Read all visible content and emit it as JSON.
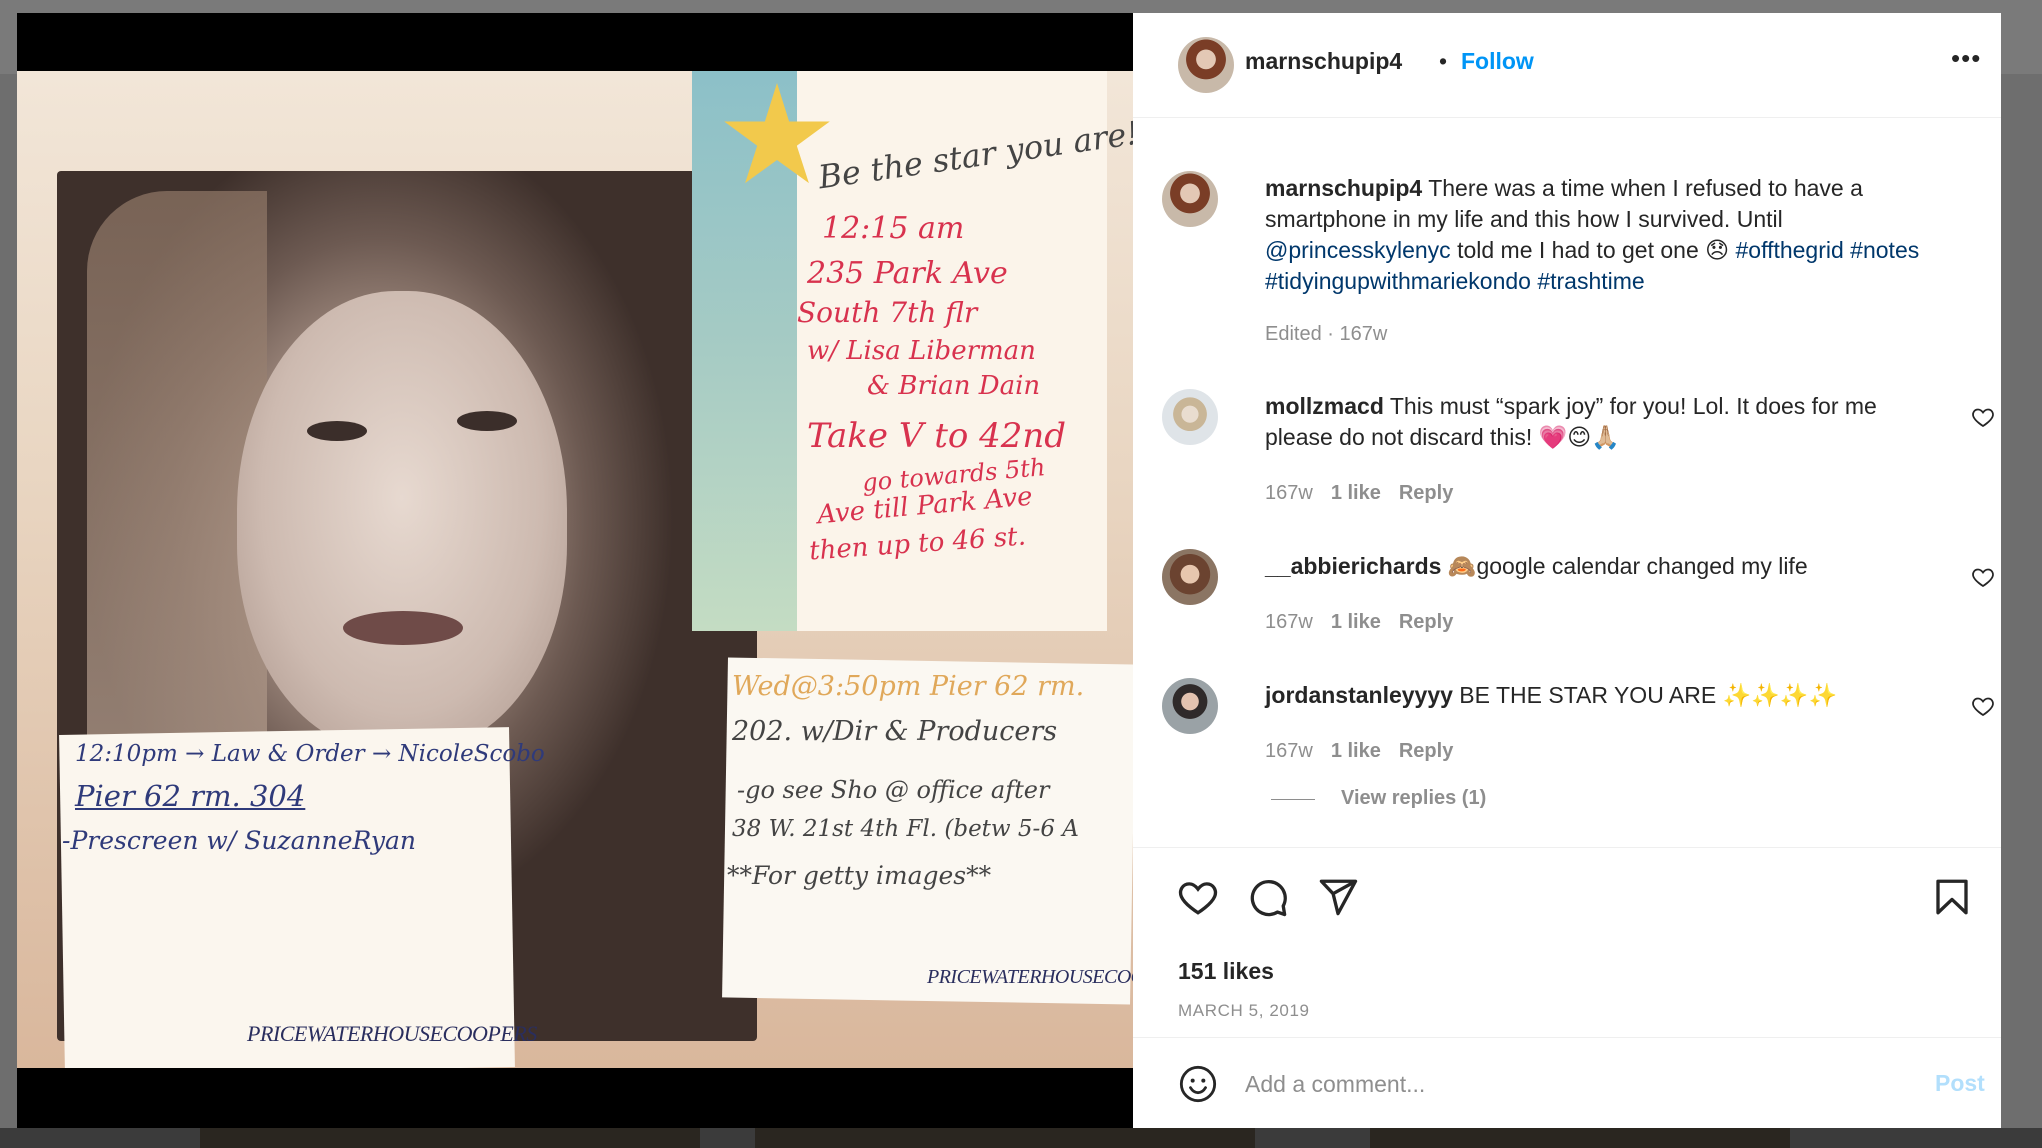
{
  "post": {
    "username": "marnschupip4",
    "separator": "•",
    "follow_label": "Follow",
    "more_label": "•••"
  },
  "photo": {
    "star_note": {
      "heading": "Be the star you are!",
      "lines": [
        "12:15 am",
        "235 Park Ave",
        "South 7th flr",
        "w/ Lisa Liberman",
        "& Brian Dain",
        "Take V to 42nd",
        "go towards 5th",
        "Ave till Park Ave",
        "then up to 46 st."
      ]
    },
    "left_note": {
      "lines": [
        "12:10pm → Law & Order → NicoleScobo",
        "Pier 62 rm. 304",
        "-Prescreen w/ SuzanneRyan"
      ]
    },
    "right_note": {
      "lines": [
        "Wed@3:50pm Pier 62 rm.",
        "202. w/Dir & Producers",
        "-go see Sho @ office after",
        "38 W. 21st 4th Fl. (betw 5-6 A",
        "**For getty images**"
      ]
    },
    "brand": "PRICEWATERHOUSECOOPERS"
  },
  "caption": {
    "username": "marnschupip4",
    "text_1": " There was a time when I refused to have a smartphone in my life and this how I survived. Until ",
    "mention": "@princesskylenyc",
    "text_2": " told me I had to get one 😞 ",
    "tags": "#offthegrid #notes #tidyingupwithmariekondo #trashtime",
    "meta": "Edited · 167w"
  },
  "comments": [
    {
      "username": "mollzmacd",
      "text": " This must “spark joy” for you! Lol. It does for me please do not discard this! 💗😊🙏🏼",
      "time": "167w",
      "likes": "1 like",
      "reply": "Reply"
    },
    {
      "username": "__abbierichards",
      "text": " 🙈google calendar changed my life",
      "time": "167w",
      "likes": "1 like",
      "reply": "Reply"
    },
    {
      "username": "jordanstanleyyyy",
      "text": " BE THE STAR YOU ARE ✨✨✨✨",
      "time": "167w",
      "likes": "1 like",
      "reply": "Reply"
    }
  ],
  "view_replies": "View replies (1)",
  "likes": "151 likes",
  "date": "MARCH 5, 2019",
  "comment_box": {
    "placeholder": "Add a comment...",
    "post_label": "Post"
  },
  "colors": {
    "accent": "#0095f6",
    "link": "#00376b",
    "post_disabled": "#b2dffc",
    "muted": "#8e8e8e"
  },
  "icons": [
    "heart-icon",
    "comment-icon",
    "share-icon",
    "bookmark-icon",
    "emoji-icon",
    "more-icon"
  ]
}
